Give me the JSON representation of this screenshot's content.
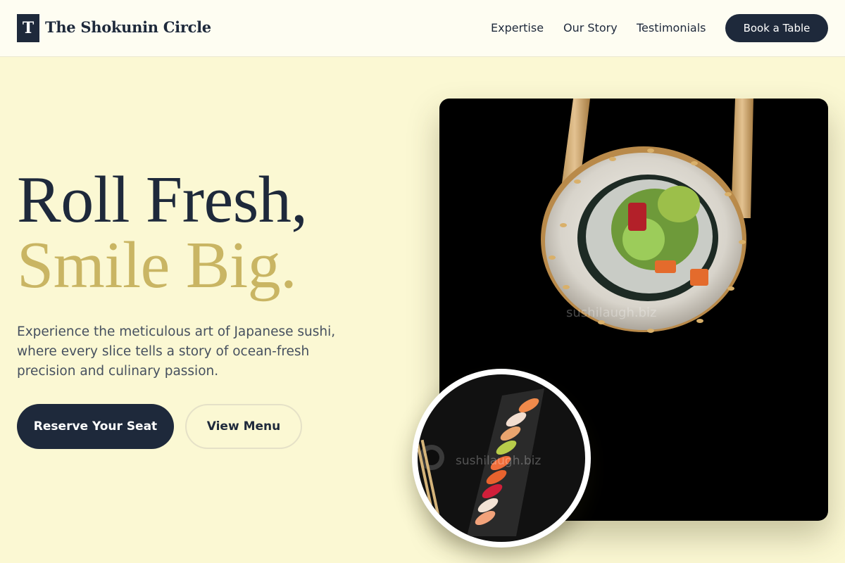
{
  "header": {
    "logo_letter": "T",
    "brand_name": "The Shokunin Circle",
    "nav": {
      "expertise": "Expertise",
      "story": "Our Story",
      "testimonials": "Testimonials"
    },
    "cta_label": "Book a Table"
  },
  "hero": {
    "headline_line1": "Roll Fresh,",
    "headline_line2": "Smile Big.",
    "description": "Experience the meticulous art of Japanese sushi, where every slice tells a story of ocean-fresh precision and culinary passion.",
    "primary_button": "Reserve Your Seat",
    "secondary_button": "View Menu",
    "main_image_watermark": "sushilaugh.biz",
    "circle_image_watermark": "sushilaugh.biz"
  },
  "colors": {
    "background": "#fbf8d3",
    "navy": "#1e293b",
    "gold": "#c9b563"
  },
  "icons": {
    "logo": "logo-mark-icon"
  }
}
